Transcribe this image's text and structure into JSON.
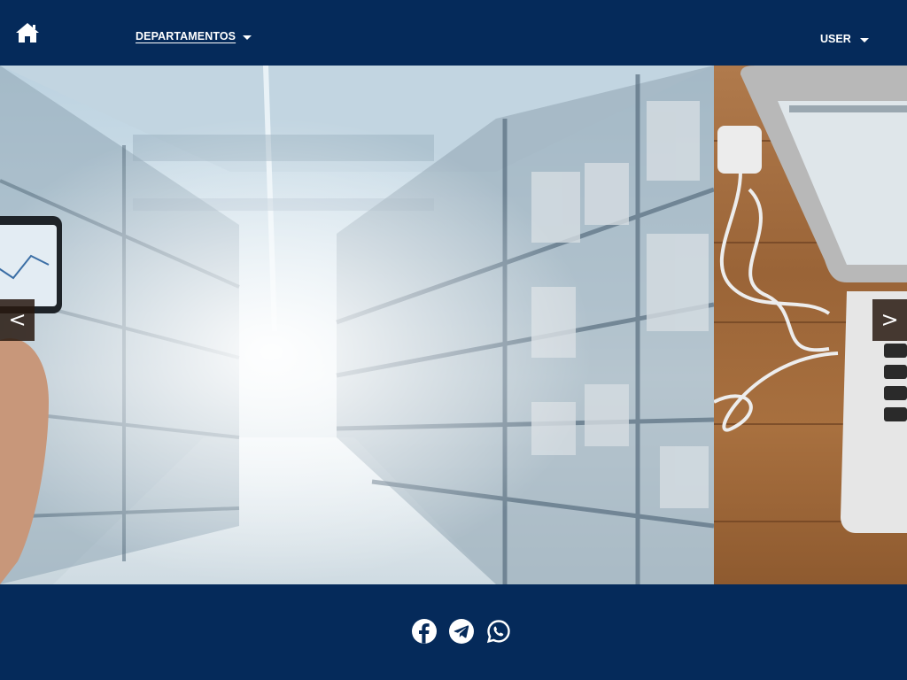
{
  "header": {
    "home_icon": "home-icon",
    "departments_label": "DEPARTAMENTOS",
    "user_label": "USER"
  },
  "carousel": {
    "prev_label": "<",
    "next_label": ">"
  },
  "footer": {
    "social_icons": [
      "facebook-icon",
      "telegram-icon",
      "whatsapp-icon"
    ]
  },
  "colors": {
    "brand_navy": "#052a5a",
    "text_white": "#ffffff"
  }
}
